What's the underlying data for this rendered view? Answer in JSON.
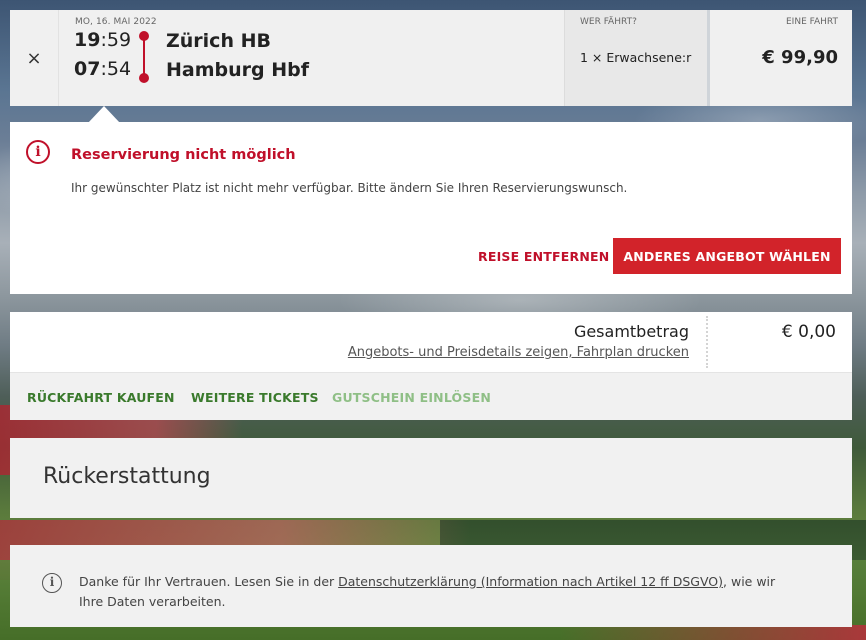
{
  "journey": {
    "close_label": "×",
    "date": "MO, 16. MAI 2022",
    "departure": {
      "hour": "19",
      "minute": ":59",
      "station": "Zürich HB"
    },
    "arrival": {
      "hour": "07",
      "minute": ":54",
      "station": "Hamburg Hbf"
    },
    "who_label": "WER FÄHRT?",
    "who_value": "1 × Erwachsene:r",
    "fare_label": "EINE FAHRT",
    "fare_value": "€ 99,90"
  },
  "error": {
    "icon": "info-icon",
    "title": "Reservierung nicht möglich",
    "message": "Ihr gewünschter Platz ist nicht mehr verfügbar. Bitte ändern Sie Ihren Reservierungswunsch.",
    "remove_label": "REISE ENTFERNEN",
    "other_offer_label": "ANDERES ANGEBOT WÄHLEN",
    "accent_color": "#c0102a"
  },
  "total": {
    "label": "Gesamtbetrag",
    "links": "Angebots- und Preisdetails zeigen, Fahrplan drucken",
    "value": "€ 0,00"
  },
  "actions": {
    "return_label": "RÜCKFAHRT KAUFEN",
    "more_tickets_label": "WEITERE TICKETS",
    "voucher_label": "GUTSCHEIN EINLÖSEN"
  },
  "refund": {
    "title": "Rückerstattung"
  },
  "privacy": {
    "prefix": "Danke für Ihr Vertrauen. Lesen Sie in der ",
    "link": "Datenschutzerklärung (Information nach Artikel 12 ff DSGVO)",
    "suffix": ", wie wir Ihre Daten verarbeiten."
  }
}
